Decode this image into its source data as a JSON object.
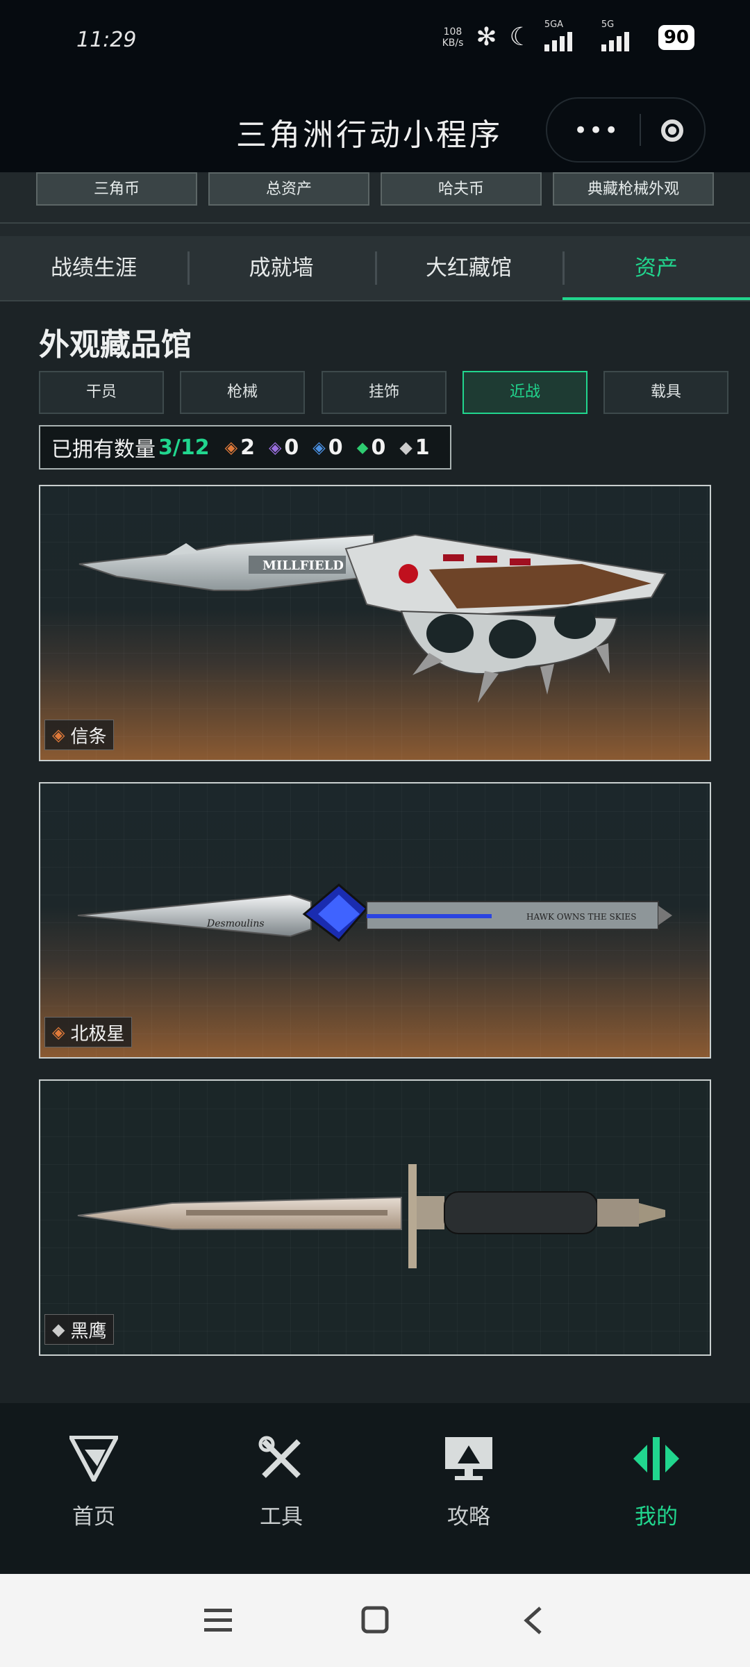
{
  "status_bar": {
    "time": "11:29",
    "net_speed": "108",
    "net_unit": "KB/s",
    "signal1_label": "5GA",
    "signal2_label": "5G",
    "battery": "90"
  },
  "mini_program": {
    "title": "三角洲行动小程序",
    "more_icon": "more-dots-icon",
    "close_icon": "target-close-icon"
  },
  "sub_tabs": [
    "三角币",
    "总资产",
    "哈夫币",
    "典藏枪械外观"
  ],
  "main_tabs": {
    "items": [
      "战绩生涯",
      "成就墙",
      "大红藏馆",
      "资产"
    ],
    "active_index": 3
  },
  "section": {
    "title": "外观藏品馆",
    "categories": [
      "干员",
      "枪械",
      "挂饰",
      "近战",
      "载具"
    ],
    "active_category_index": 3
  },
  "owned": {
    "label": "已拥有数量",
    "fraction": "3/12",
    "rarity_counts": [
      {
        "icon": "orange-diamond-icon",
        "color": "#e07a3a",
        "count": "2"
      },
      {
        "icon": "purple-diamond-icon",
        "color": "#9b6fe0",
        "count": "0"
      },
      {
        "icon": "blue-diamond-icon",
        "color": "#4a90e2",
        "count": "0"
      },
      {
        "icon": "green-diamond-icon",
        "color": "#2ecc71",
        "count": "0"
      },
      {
        "icon": "white-diamond-icon",
        "color": "#cccccc",
        "count": "1"
      }
    ]
  },
  "items": [
    {
      "name": "信条",
      "rarity_icon": "orange-diamond-icon",
      "rarity_color": "#e07a3a",
      "engraving": "MILLFIELD"
    },
    {
      "name": "北极星",
      "rarity_icon": "orange-diamond-icon",
      "rarity_color": "#e07a3a",
      "engraving": "Desmoulins",
      "engraving2": "HAWK OWNS THE SKIES"
    },
    {
      "name": "黑鹰",
      "rarity_icon": "white-diamond-icon",
      "rarity_color": "#cccccc"
    }
  ],
  "bottom_nav": {
    "items": [
      {
        "label": "首页",
        "icon": "home-g-icon"
      },
      {
        "label": "工具",
        "icon": "tools-icon"
      },
      {
        "label": "攻略",
        "icon": "guide-monitor-icon"
      },
      {
        "label": "我的",
        "icon": "profile-logo-icon"
      }
    ],
    "active_index": 3
  },
  "system_nav": [
    "menu-icon",
    "home-square-icon",
    "back-icon"
  ],
  "colors": {
    "accent": "#21d68e"
  }
}
